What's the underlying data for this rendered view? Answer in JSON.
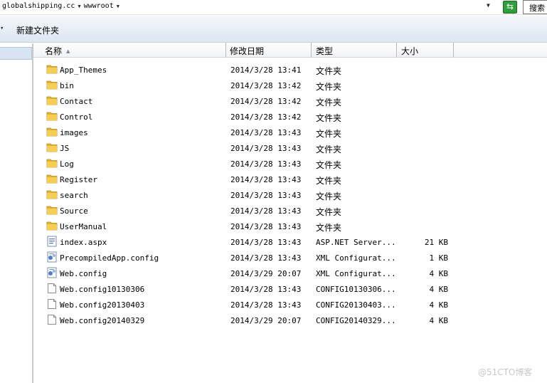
{
  "address_bar": {
    "crumbs": [
      "globalshipping.cc",
      "wwwroot"
    ],
    "search_label": "搜索"
  },
  "toolbar": {
    "new_folder_label": "新建文件夹"
  },
  "columns": {
    "name": "名称",
    "date": "修改日期",
    "type": "类型",
    "size": "大小"
  },
  "files": [
    {
      "name": "App_Themes",
      "date": "2014/3/28 13:41",
      "type": "文件夹",
      "size": "",
      "icon": "folder-icon"
    },
    {
      "name": "bin",
      "date": "2014/3/28 13:42",
      "type": "文件夹",
      "size": "",
      "icon": "folder-icon"
    },
    {
      "name": "Contact",
      "date": "2014/3/28 13:42",
      "type": "文件夹",
      "size": "",
      "icon": "folder-icon"
    },
    {
      "name": "Control",
      "date": "2014/3/28 13:42",
      "type": "文件夹",
      "size": "",
      "icon": "folder-icon"
    },
    {
      "name": "images",
      "date": "2014/3/28 13:43",
      "type": "文件夹",
      "size": "",
      "icon": "folder-icon"
    },
    {
      "name": "JS",
      "date": "2014/3/28 13:43",
      "type": "文件夹",
      "size": "",
      "icon": "folder-icon"
    },
    {
      "name": "Log",
      "date": "2014/3/28 13:43",
      "type": "文件夹",
      "size": "",
      "icon": "folder-icon"
    },
    {
      "name": "Register",
      "date": "2014/3/28 13:43",
      "type": "文件夹",
      "size": "",
      "icon": "folder-icon"
    },
    {
      "name": "search",
      "date": "2014/3/28 13:43",
      "type": "文件夹",
      "size": "",
      "icon": "folder-icon"
    },
    {
      "name": "Source",
      "date": "2014/3/28 13:43",
      "type": "文件夹",
      "size": "",
      "icon": "folder-icon"
    },
    {
      "name": "UserManual",
      "date": "2014/3/28 13:43",
      "type": "文件夹",
      "size": "",
      "icon": "folder-icon"
    },
    {
      "name": "index.aspx",
      "date": "2014/3/28 13:43",
      "type": "ASP.NET Server...",
      "size": "21 KB",
      "icon": "aspx-file-icon"
    },
    {
      "name": "PrecompiledApp.config",
      "date": "2014/3/28 13:43",
      "type": "XML Configurat...",
      "size": "1 KB",
      "icon": "config-file-icon"
    },
    {
      "name": "Web.config",
      "date": "2014/3/29 20:07",
      "type": "XML Configurat...",
      "size": "4 KB",
      "icon": "config-file-icon"
    },
    {
      "name": "Web.config10130306",
      "date": "2014/3/28 13:43",
      "type": "CONFIG10130306...",
      "size": "4 KB",
      "icon": "blank-file-icon"
    },
    {
      "name": "Web.config20130403",
      "date": "2014/3/28 13:43",
      "type": "CONFIG20130403...",
      "size": "4 KB",
      "icon": "blank-file-icon"
    },
    {
      "name": "Web.config20140329",
      "date": "2014/3/29 20:07",
      "type": "CONFIG20140329...",
      "size": "4 KB",
      "icon": "blank-file-icon"
    }
  ],
  "watermark": "@51CTO博客"
}
